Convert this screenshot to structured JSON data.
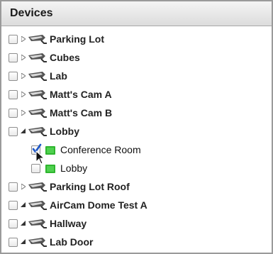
{
  "panel": {
    "title": "Devices"
  },
  "devices": [
    {
      "label": "Parking Lot",
      "expanded": false,
      "checked": false
    },
    {
      "label": "Cubes",
      "expanded": false,
      "checked": false
    },
    {
      "label": "Lab",
      "expanded": false,
      "checked": false
    },
    {
      "label": "Matt's Cam A",
      "expanded": false,
      "checked": false
    },
    {
      "label": "Matt's Cam B",
      "expanded": false,
      "checked": false
    },
    {
      "label": "Lobby",
      "expanded": true,
      "checked": false,
      "children": [
        {
          "label": "Conference Room",
          "checked": true
        },
        {
          "label": "Lobby",
          "checked": false
        }
      ]
    },
    {
      "label": "Parking Lot Roof",
      "expanded": false,
      "checked": false
    },
    {
      "label": "AirCam Dome Test A",
      "expanded": true,
      "checked": false
    },
    {
      "label": "Hallway",
      "expanded": true,
      "checked": false
    },
    {
      "label": "Lab Door",
      "expanded": true,
      "checked": false
    }
  ],
  "colors": {
    "status_green": "#2fb52f",
    "checkmark": "#1e58c8",
    "header_text": "#1a1a1a"
  },
  "icons": {
    "camera": "camera-icon",
    "expand": "triangle-right-icon",
    "collapse": "triangle-down-icon",
    "status": "green-status-icon",
    "pointer": "mouse-pointer-icon"
  }
}
